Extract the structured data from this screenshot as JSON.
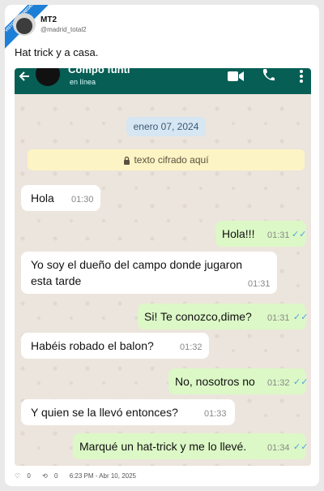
{
  "ribbon": {
    "line1": "VISTOENLASREDES",
    "line2": ".com"
  },
  "author": {
    "name": "MT2",
    "handle": "@madrid_total2"
  },
  "tweet": {
    "text": "Hat trick y a casa."
  },
  "chat": {
    "contact_name": "Compo funti",
    "contact_status": "en línea",
    "date": "enero 07, 2024",
    "encrypted_notice": "texto cifrado aquí",
    "messages": [
      {
        "dir": "in",
        "text": "Hola",
        "time": "01:30"
      },
      {
        "dir": "out",
        "text": "Hola!!!",
        "time": "01:31"
      },
      {
        "dir": "in",
        "text_line1": "Yo soy el dueño del campo donde jugaron",
        "text_line2": "esta tarde",
        "time": "01:31"
      },
      {
        "dir": "out",
        "text": "Si! Te conozco,dime?",
        "time": "01:31"
      },
      {
        "dir": "in",
        "text": "Habéis robado el balon?",
        "time": "01:32"
      },
      {
        "dir": "out",
        "text": "No, nosotros no",
        "time": "01:32"
      },
      {
        "dir": "in",
        "text": "Y quien se la llevó entonces?",
        "time": "01:33"
      },
      {
        "dir": "out",
        "text": "Marqué un hat-trick y me lo llevé.",
        "time": "01:34"
      }
    ]
  },
  "footer": {
    "likes": "0",
    "retweets": "0",
    "timestamp": "6:23 PM - Abr 10, 2025"
  },
  "colors": {
    "whatsapp_header": "#075e54",
    "bubble_out": "#dcf8c6",
    "bubble_in": "#ffffff",
    "read_ticks": "#4fa3e0"
  }
}
